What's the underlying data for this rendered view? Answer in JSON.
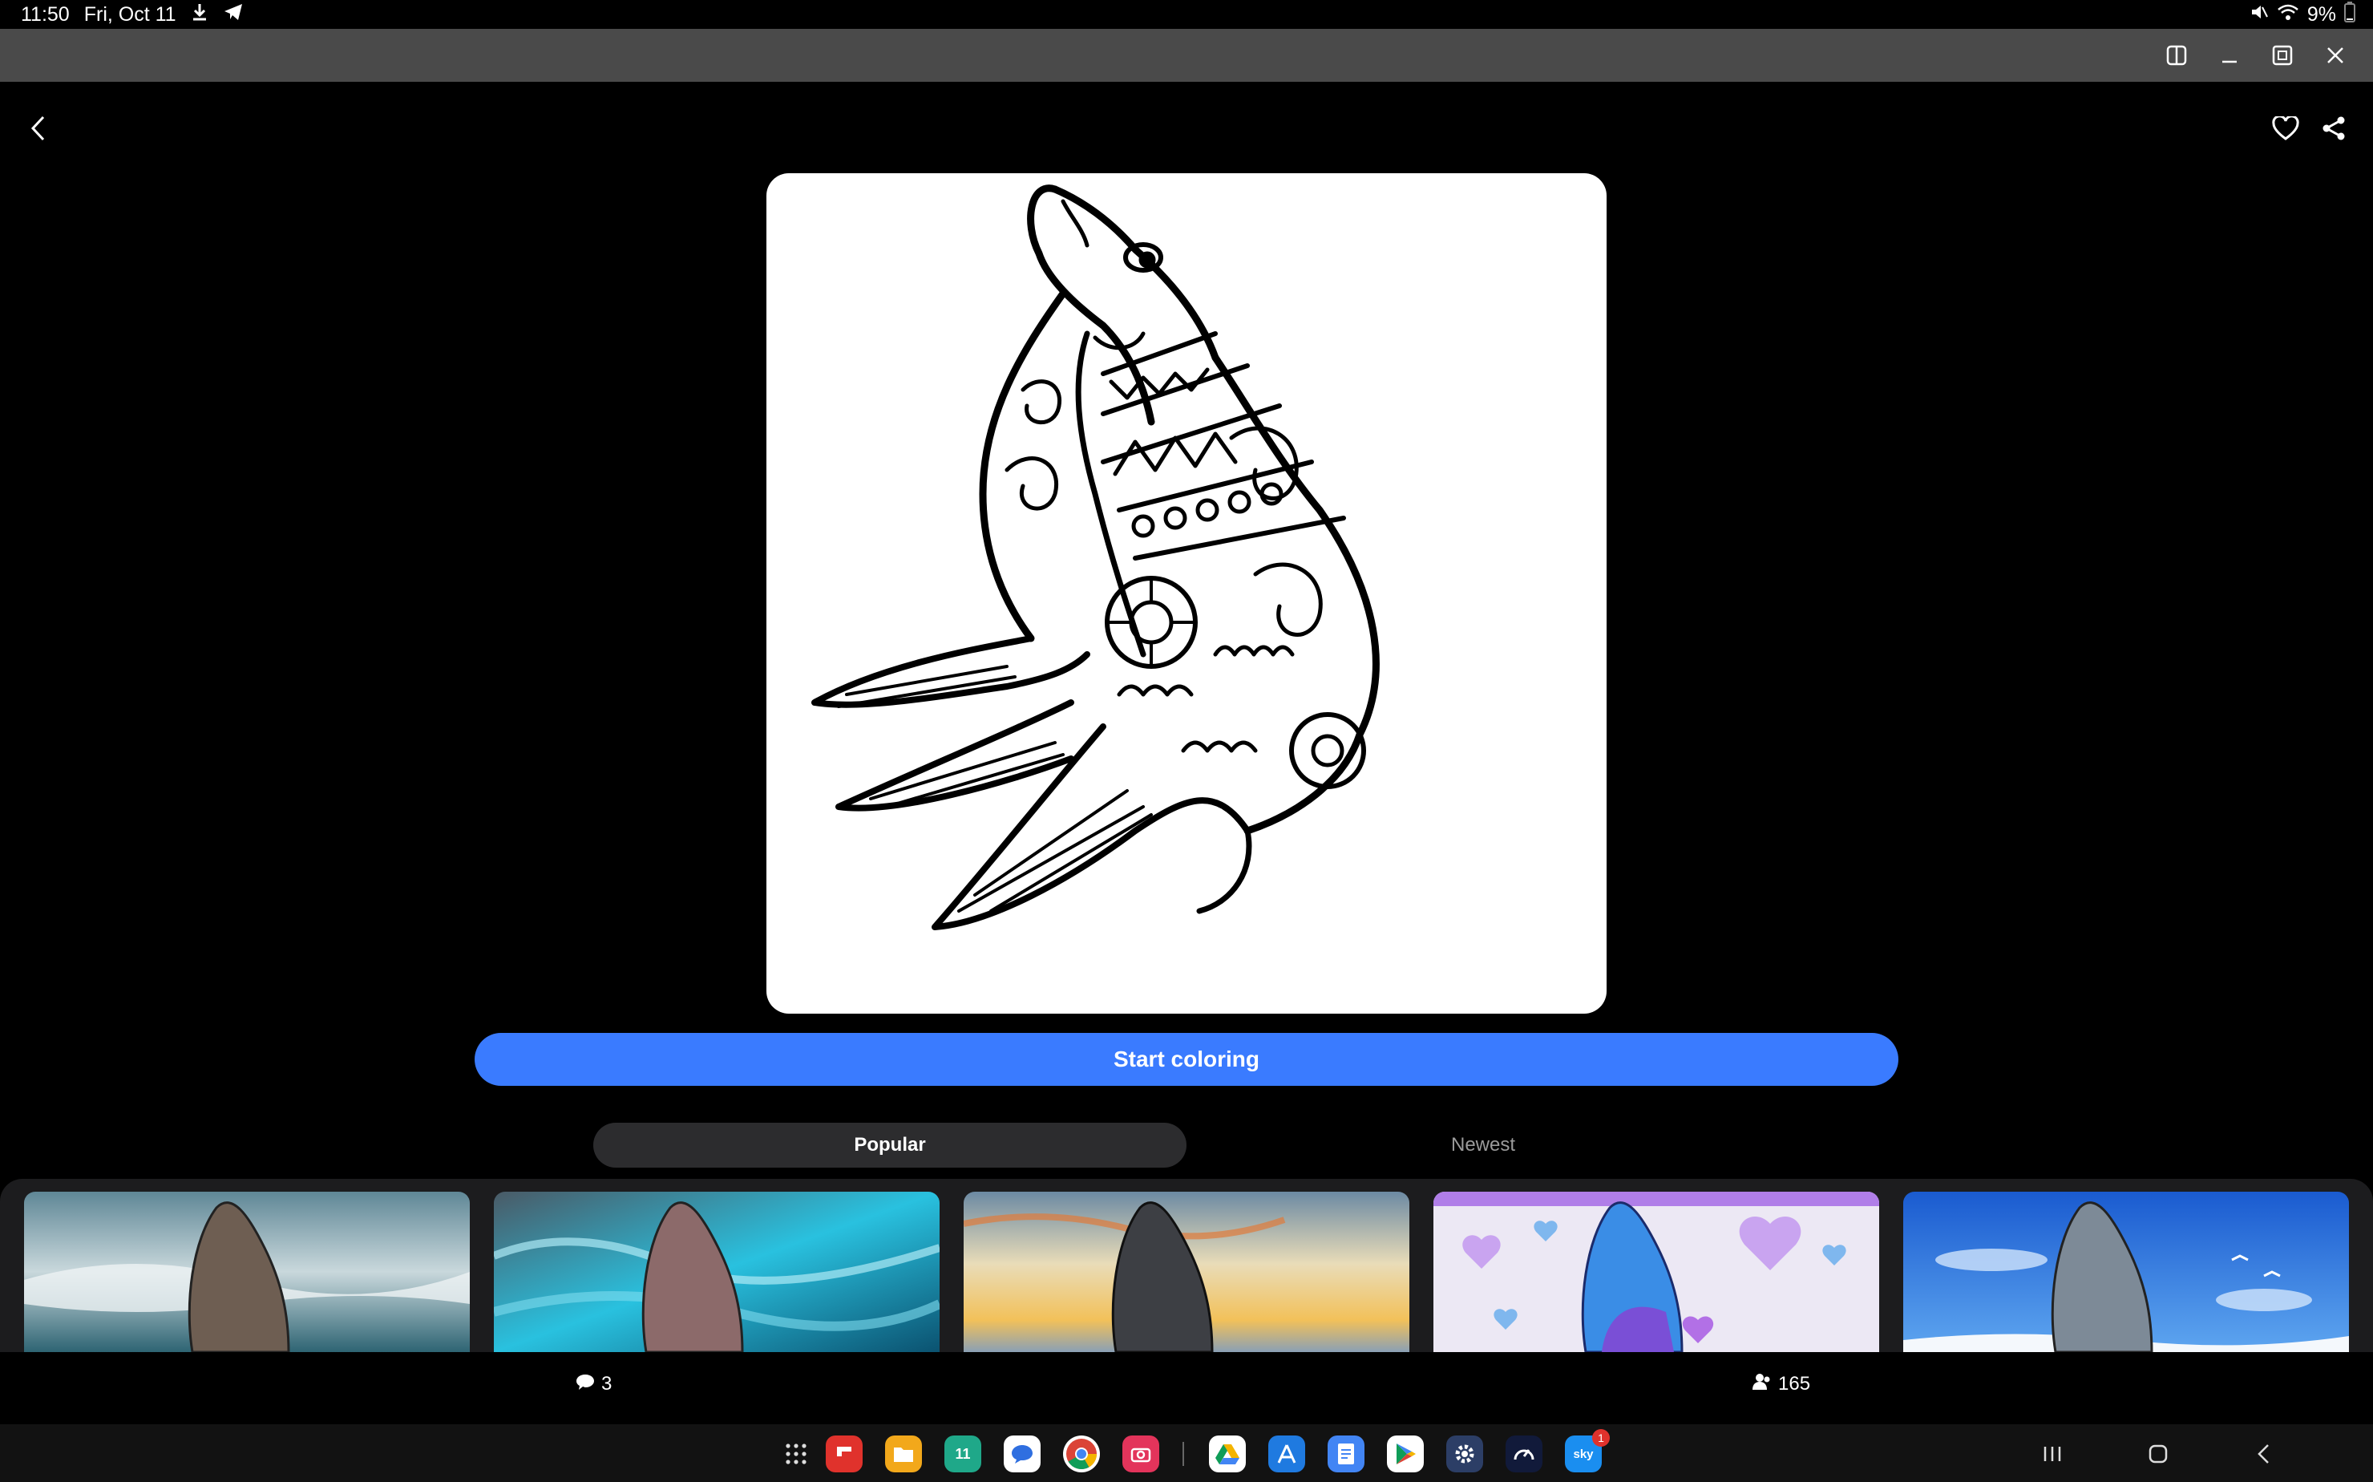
{
  "status_bar": {
    "time": "11:50",
    "date": "Fri, Oct 11",
    "battery": "9%",
    "icons_left": [
      "download-icon",
      "telegram-icon"
    ],
    "icons_right": [
      "mute-icon",
      "wifi-icon",
      "battery-icon"
    ]
  },
  "window_controls": [
    "split-view-icon",
    "minimize-icon",
    "popup-view-icon",
    "close-icon"
  ],
  "header": {
    "back_icon": "chevron-left-icon",
    "favorite_icon": "heart-icon",
    "share_icon": "share-icon"
  },
  "artwork": {
    "subject": "seal coloring page (line art)"
  },
  "start_button": {
    "label": "Start coloring",
    "color": "#3a7bff"
  },
  "tabs": [
    {
      "label": "Popular",
      "active": true
    },
    {
      "label": "Newest",
      "active": false
    }
  ],
  "gallery": {
    "items": [
      {
        "theme": "ocean-waves"
      },
      {
        "theme": "turquoise-storm"
      },
      {
        "theme": "sunset-sky"
      },
      {
        "theme": "purple-hearts"
      },
      {
        "theme": "blue-sky-clouds"
      }
    ]
  },
  "stats": {
    "comments_count": "3",
    "comments_icon": "comment-icon",
    "participants_count": "165",
    "participants_icon": "people-icon"
  },
  "taskbar": {
    "apps": [
      "app-drawer-icon",
      "flipboard-icon",
      "my-files-icon",
      "calendar-icon",
      "messages-icon",
      "chrome-icon",
      "camera-icon",
      "drive-icon",
      "app-store-icon",
      "docs-icon",
      "play-store-icon",
      "settings-icon",
      "speedometer-icon",
      "sky-icon"
    ],
    "calendar_day": "11",
    "sky_label": "sky",
    "sky_badge": "1",
    "nav": [
      "recents-icon",
      "home-icon",
      "back-icon"
    ]
  }
}
